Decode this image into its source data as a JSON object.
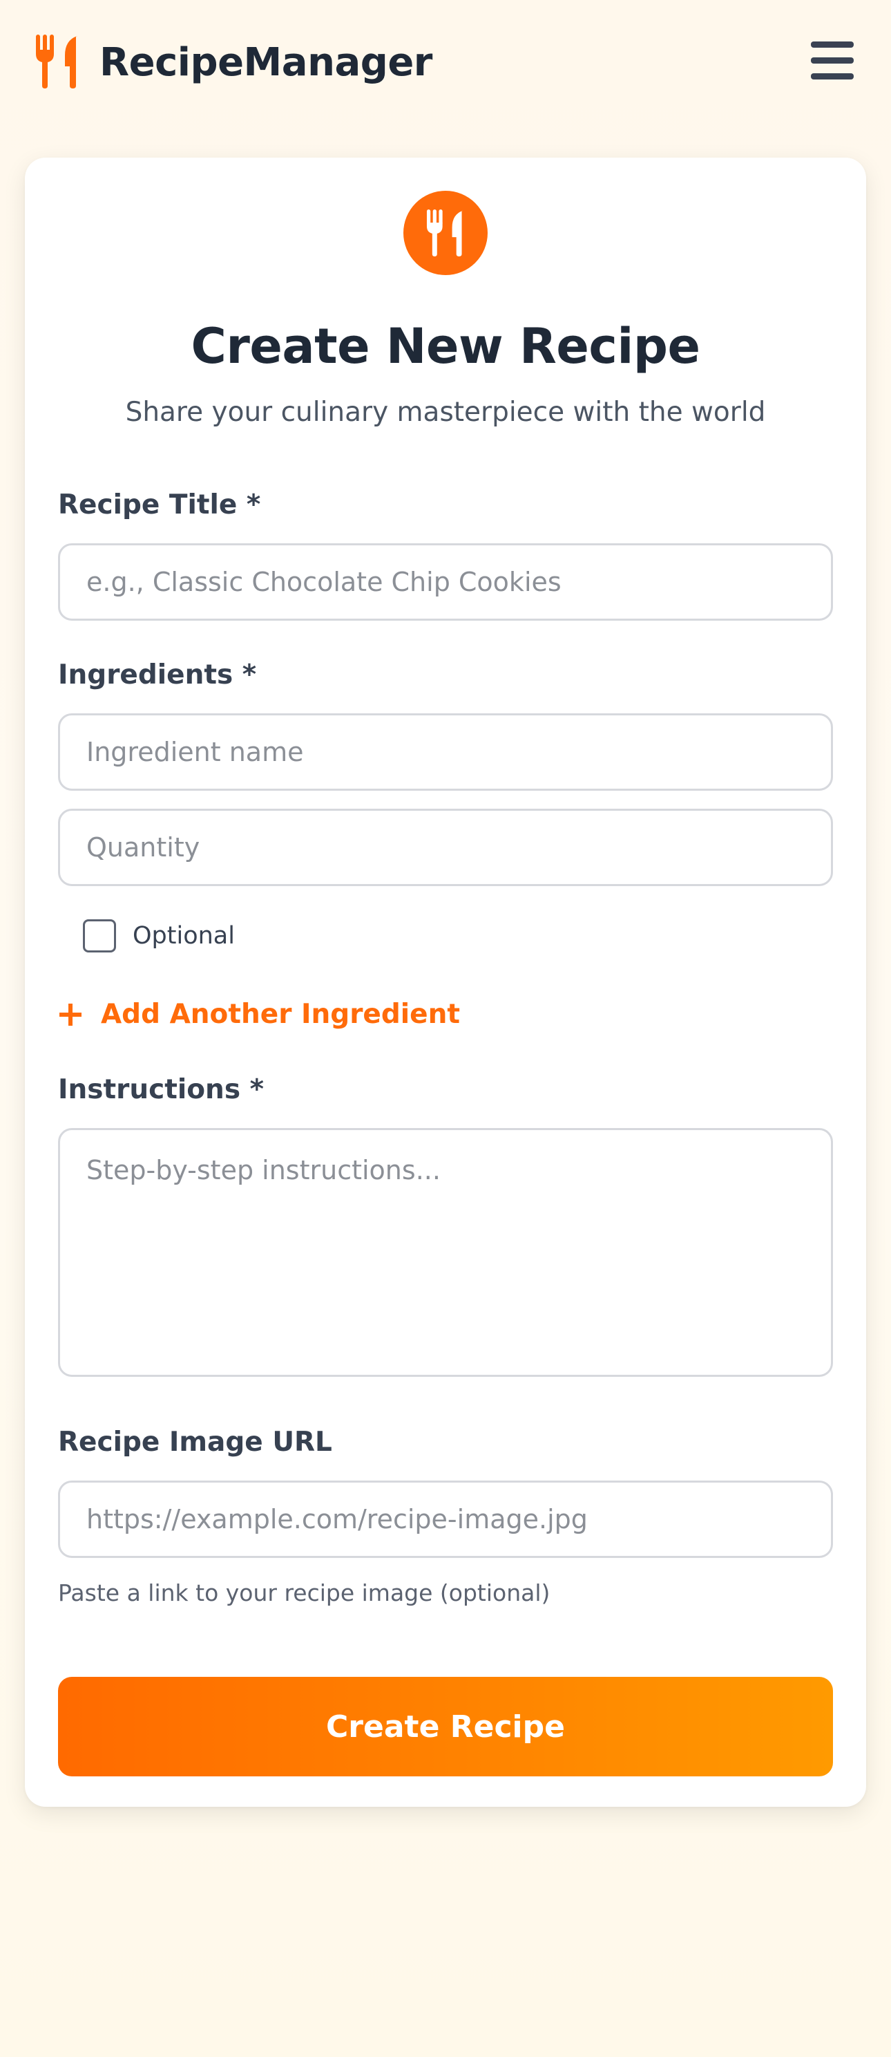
{
  "header": {
    "logo_icon": "utensils-icon",
    "brand": "RecipeManager",
    "menu_icon": "hamburger-menu-icon"
  },
  "colors": {
    "accent": "#ff6b0a",
    "button_gradient_start": "#ff6a00",
    "button_gradient_end": "#ff9a00",
    "text_dark": "#1f2937",
    "background": "#fff8ec"
  },
  "form": {
    "hero_icon": "utensils-icon",
    "title": "Create New Recipe",
    "subtitle": "Share your culinary masterpiece with the world",
    "recipe_title": {
      "label": "Recipe Title *",
      "value": "",
      "placeholder": "e.g., Classic Chocolate Chip Cookies"
    },
    "ingredients": {
      "label": "Ingredients *",
      "name_value": "",
      "name_placeholder": "Ingredient name",
      "quantity_value": "",
      "quantity_placeholder": "Quantity",
      "optional_label": "Optional",
      "optional_checked": false,
      "add_icon": "plus-icon",
      "add_label": "Add Another Ingredient"
    },
    "instructions": {
      "label": "Instructions *",
      "value": "",
      "placeholder": "Step-by-step instructions..."
    },
    "image_url": {
      "label": "Recipe Image URL",
      "value": "",
      "placeholder": "https://example.com/recipe-image.jpg",
      "hint": "Paste a link to your recipe image (optional)"
    },
    "submit_label": "Create Recipe"
  }
}
